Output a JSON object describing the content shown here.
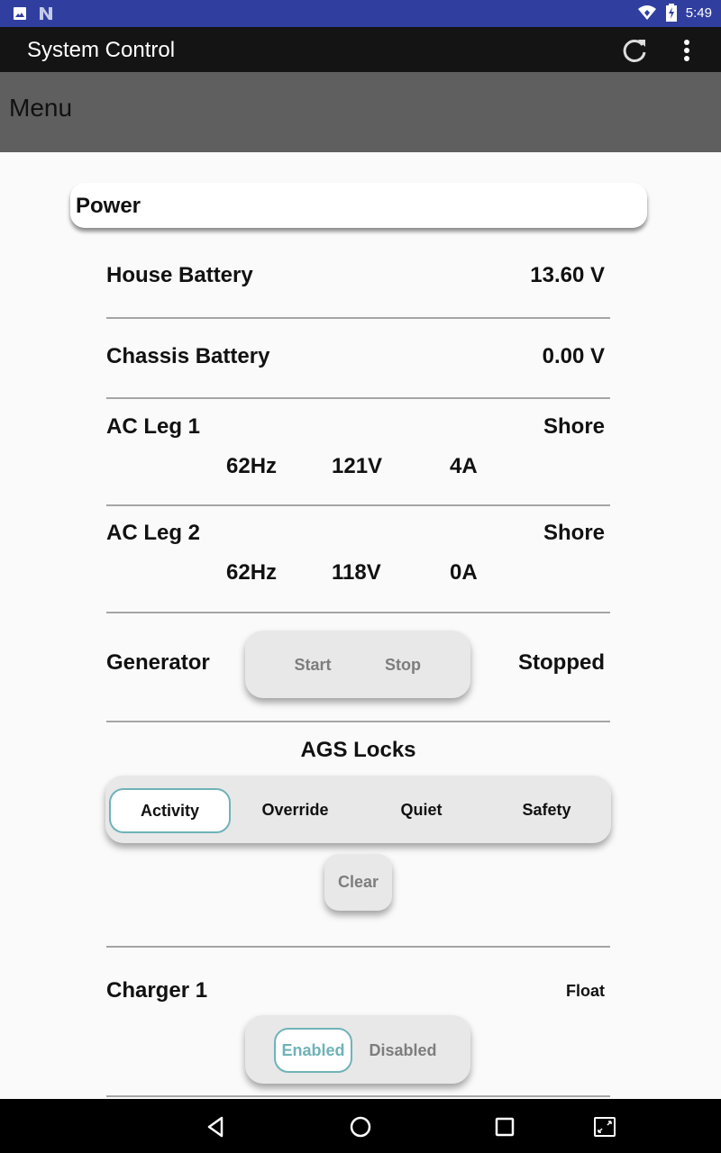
{
  "status_bar": {
    "time": "5:49",
    "left_icons": [
      "image-notification-icon",
      "n-notification-icon"
    ],
    "right_icons": [
      "wifi-icon",
      "battery-charging-icon"
    ]
  },
  "app_bar": {
    "title": "System Control",
    "actions": [
      "refresh-icon",
      "overflow-menu-icon"
    ]
  },
  "menu": {
    "label": "Menu"
  },
  "power": {
    "header": "Power",
    "house_battery": {
      "label": "House Battery",
      "value": "13.60 V"
    },
    "chassis_battery": {
      "label": "Chassis Battery",
      "value": "0.00 V"
    },
    "ac_leg_1": {
      "label": "AC Leg 1",
      "source": "Shore",
      "frequency": "62Hz",
      "voltage": "121V",
      "current": "4A"
    },
    "ac_leg_2": {
      "label": "AC Leg 2",
      "source": "Shore",
      "frequency": "62Hz",
      "voltage": "118V",
      "current": "0A"
    },
    "generator": {
      "label": "Generator",
      "start_label": "Start",
      "stop_label": "Stop",
      "status": "Stopped"
    },
    "ags_locks": {
      "title": "AGS Locks",
      "options": [
        "Activity",
        "Override",
        "Quiet",
        "Safety"
      ],
      "selected": "Activity",
      "clear_label": "Clear"
    },
    "charger_1": {
      "label": "Charger 1",
      "status": "Float",
      "options": [
        "Enabled",
        "Disabled"
      ],
      "selected": "Enabled"
    }
  },
  "colors": {
    "status_bar": "#303f9f",
    "app_bar": "#141414",
    "menu_bar": "#5f5f5f",
    "accent": "#6fb3b8"
  },
  "nav_bar": {
    "buttons": [
      "back-icon",
      "home-icon",
      "recents-icon",
      "screen-rotate-icon"
    ]
  }
}
